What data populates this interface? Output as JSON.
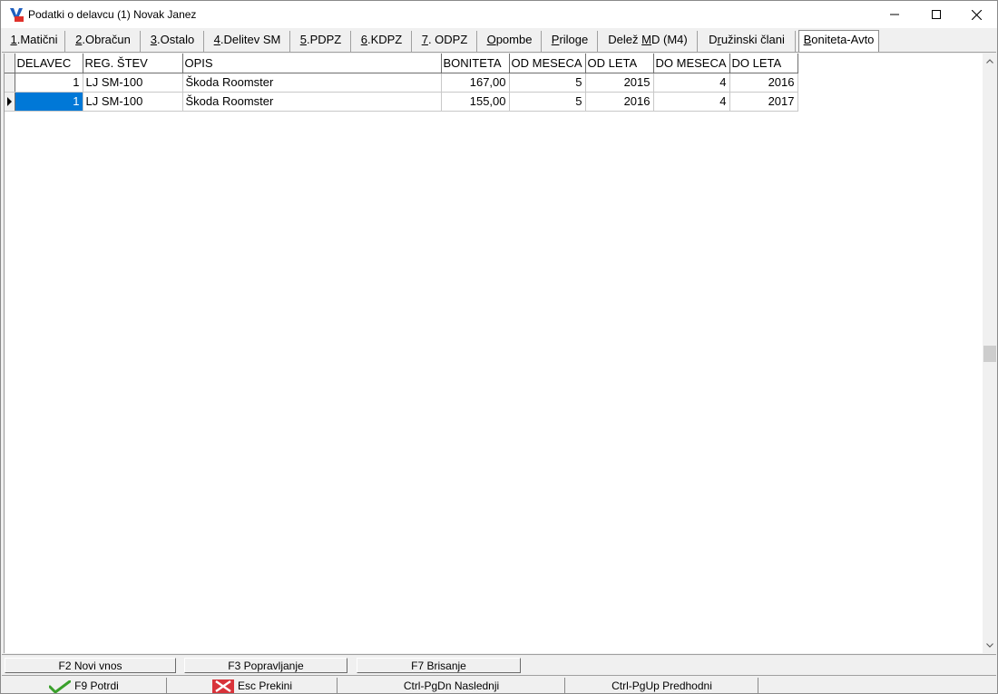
{
  "window": {
    "title": "Podatki o delavcu (1) Novak Janez",
    "icon_text": "PLACE"
  },
  "tabs": [
    {
      "mnemonic": "1",
      "rest": ".Matični",
      "active": false
    },
    {
      "mnemonic": "2",
      "rest": ".Obračun",
      "active": false
    },
    {
      "mnemonic": "3",
      "rest": ".Ostalo",
      "active": false
    },
    {
      "mnemonic": "4",
      "rest": ".Delitev SM",
      "active": false
    },
    {
      "mnemonic": "5",
      "rest": ".PDPZ",
      "active": false
    },
    {
      "mnemonic": "6",
      "rest": ".KDPZ",
      "active": false
    },
    {
      "mnemonic": "7",
      "rest": ". ODPZ",
      "active": false
    },
    {
      "mnemonic": "O",
      "rest": "pombe",
      "active": false
    },
    {
      "mnemonic": "P",
      "rest": "riloge",
      "active": false
    },
    {
      "pre": "Delež ",
      "mnemonic": "M",
      "rest": "D (M4)",
      "active": false
    },
    {
      "pre": "D",
      "mnemonic": "r",
      "rest": "užinski člani",
      "active": false
    },
    {
      "mnemonic": "B",
      "rest": "oniteta-Avto",
      "active": true
    }
  ],
  "grid": {
    "columns": [
      "DELAVEC",
      "REG. ŠTEV",
      "OPIS",
      "BONITETA",
      "OD MESECA",
      "OD LETA",
      "DO MESECA",
      "DO LETA"
    ],
    "rows": [
      {
        "delavec": "1",
        "reg": "LJ SM-100",
        "opis": "Škoda Roomster",
        "boniteta": "167,00",
        "od_meseca": "5",
        "od_leta": "2015",
        "do_meseca": "4",
        "do_leta": "2016",
        "current": false
      },
      {
        "delavec": "1",
        "reg": "LJ SM-100",
        "opis": "Škoda Roomster",
        "boniteta": "155,00",
        "od_meseca": "5",
        "od_leta": "2016",
        "do_meseca": "4",
        "do_leta": "2017",
        "current": true
      }
    ]
  },
  "toolbar_edit": {
    "new_label": "F2  Novi vnos",
    "edit_label": "F3  Popravljanje",
    "delete_label": "F7  Brisanje"
  },
  "toolbar_nav": {
    "confirm_label": "F9 Potrdi",
    "cancel_label": "Esc Prekini",
    "next_label": "Ctrl-PgDn  Naslednji",
    "prev_label": "Ctrl-PgUp  Predhodni"
  },
  "colors": {
    "selection": "#0078d7",
    "confirm_icon": "#3aa02c",
    "cancel_icon": "#d8333a"
  }
}
